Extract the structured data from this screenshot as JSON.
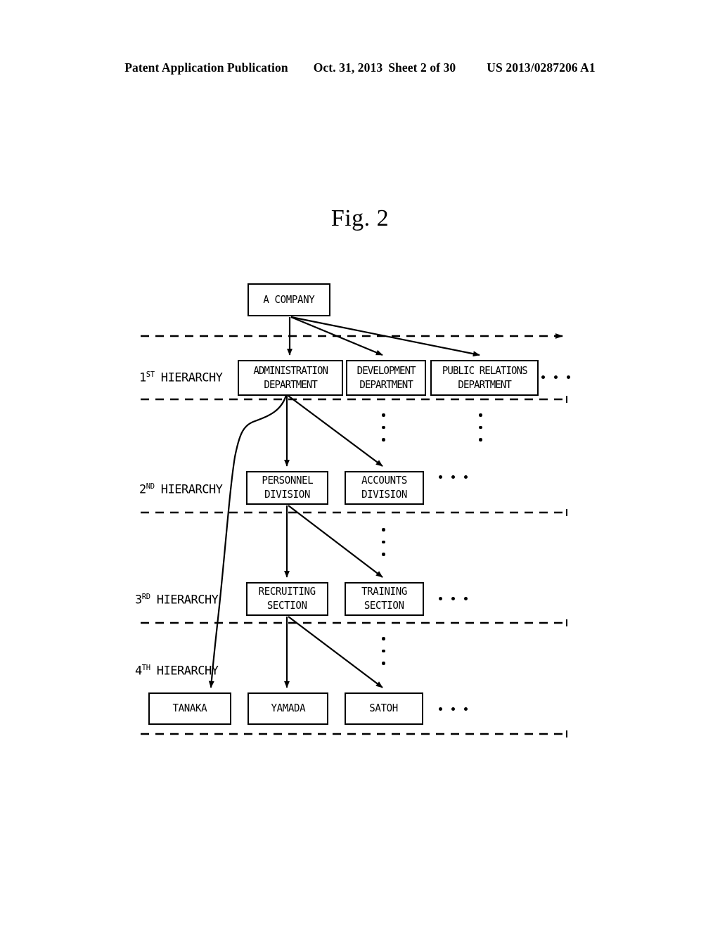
{
  "header": {
    "publication": "Patent Application Publication",
    "date": "Oct. 31, 2013",
    "sheet": "Sheet 2 of 30",
    "number": "US 2013/0287206 A1"
  },
  "figure": {
    "title": "Fig. 2",
    "ink_color": "#000000",
    "paper_color": "#ffffff"
  },
  "hierarchy_labels": [
    {
      "ordinal": "1",
      "suffix": "ST",
      "word": "HIERARCHY"
    },
    {
      "ordinal": "2",
      "suffix": "ND",
      "word": "HIERARCHY"
    },
    {
      "ordinal": "3",
      "suffix": "RD",
      "word": "HIERARCHY"
    },
    {
      "ordinal": "4",
      "suffix": "TH",
      "word": "HIERARCHY"
    }
  ],
  "nodes": {
    "root": {
      "line1": "A COMPANY",
      "line2": ""
    },
    "level1": [
      {
        "line1": "ADMINISTRATION",
        "line2": "DEPARTMENT"
      },
      {
        "line1": "DEVELOPMENT",
        "line2": "DEPARTMENT"
      },
      {
        "line1": "PUBLIC RELATIONS",
        "line2": "DEPARTMENT"
      }
    ],
    "level2": [
      {
        "line1": "PERSONNEL",
        "line2": "DIVISION"
      },
      {
        "line1": "ACCOUNTS",
        "line2": "DIVISION"
      }
    ],
    "level3": [
      {
        "line1": "RECRUITING",
        "line2": "SECTION"
      },
      {
        "line1": "TRAINING",
        "line2": "SECTION"
      }
    ],
    "level4": [
      {
        "line1": "TANAKA",
        "line2": ""
      },
      {
        "line1": "YAMADA",
        "line2": ""
      },
      {
        "line1": "SATOH",
        "line2": ""
      }
    ]
  },
  "ellipses": {
    "horizontal_count": 3,
    "vertical_count": 3
  }
}
